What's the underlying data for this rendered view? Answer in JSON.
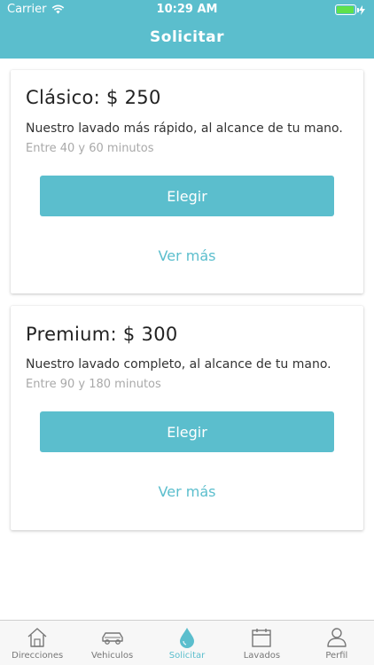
{
  "status_bar": {
    "carrier": "Carrier",
    "time": "10:29 AM",
    "battery_percent": 0.95
  },
  "header": {
    "title": "Solicitar"
  },
  "plans": [
    {
      "title": "Clásico: $ 250",
      "description": "Nuestro lavado más rápido, al alcance de tu mano.",
      "duration": "Entre 40 y 60 minutos",
      "choose_label": "Elegir",
      "more_label": "Ver más"
    },
    {
      "title": "Premium: $ 300",
      "description": "Nuestro lavado completo, al alcance de tu mano.",
      "duration": "Entre 90 y 180 minutos",
      "choose_label": "Elegir",
      "more_label": "Ver más"
    }
  ],
  "tabbar": {
    "tabs": [
      {
        "label": "Direcciones",
        "icon": "house-icon"
      },
      {
        "label": "Vehiculos",
        "icon": "car-icon"
      },
      {
        "label": "Solicitar",
        "icon": "water-drop-icon",
        "active": true
      },
      {
        "label": "Lavados",
        "icon": "calendar-icon"
      },
      {
        "label": "Perfil",
        "icon": "person-icon"
      }
    ]
  },
  "colors": {
    "accent": "#5bbecd",
    "battery": "#5fe14c",
    "muted_text": "#a9a9a9",
    "inactive_tab": "#777777"
  }
}
